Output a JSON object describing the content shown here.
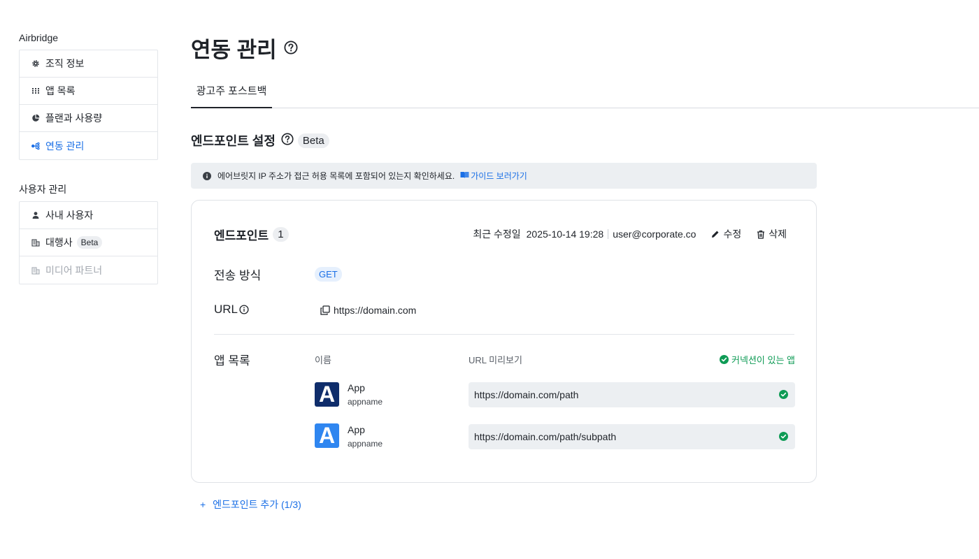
{
  "sidebar": {
    "group1_title": "Airbridge",
    "group1_items": [
      {
        "label": "조직 정보",
        "icon": "gear-icon"
      },
      {
        "label": "앱 목록",
        "icon": "grid-icon"
      },
      {
        "label": "플랜과 사용량",
        "icon": "pie-chart-icon"
      },
      {
        "label": "연동 관리",
        "icon": "integration-icon"
      }
    ],
    "group2_title": "사용자 관리",
    "group2_items": [
      {
        "label": "사내 사용자",
        "icon": "user-icon"
      },
      {
        "label": "대행사",
        "icon": "building-icon",
        "badge": "Beta"
      },
      {
        "label": "미디어 파트너",
        "icon": "building-icon"
      }
    ]
  },
  "header": {
    "title": "연동 관리"
  },
  "tabs": [
    {
      "label": "광고주 포스트백"
    }
  ],
  "section": {
    "title": "엔드포인트 설정",
    "badge": "Beta"
  },
  "notice": {
    "text": "에어브릿지 IP 주소가 접근 허용 목록에 포함되어 있는지 확인하세요.",
    "link": "가이드 보러가기"
  },
  "endpoint": {
    "title": "엔드포인트",
    "count": "1",
    "modified_label": "최근 수정일",
    "modified_date": "2025-10-14 19:28",
    "modified_by": "user@corporate.co",
    "edit_label": "수정",
    "delete_label": "삭제",
    "method_label": "전송 방식",
    "method": "GET",
    "url_label": "URL",
    "url": "https://domain.com",
    "apps_label": "앱 목록",
    "col_name": "이름",
    "col_preview": "URL 미리보기",
    "connected_label": "커넥션이 있는 앱",
    "apps": [
      {
        "name": "App",
        "sub": "appname",
        "letter": "A",
        "color": "#0f2d6b",
        "url": "https://domain.com/path"
      },
      {
        "name": "App",
        "sub": "appname",
        "letter": "A",
        "color": "#2f86f0",
        "url": "https://domain.com/path/subpath"
      }
    ]
  },
  "add_endpoint": {
    "plus": "+",
    "label": "엔드포인트 추가 (1/3)"
  },
  "colors": {
    "accent": "#1a6fe6",
    "success": "#0e9b55",
    "text": "#1f2329"
  }
}
